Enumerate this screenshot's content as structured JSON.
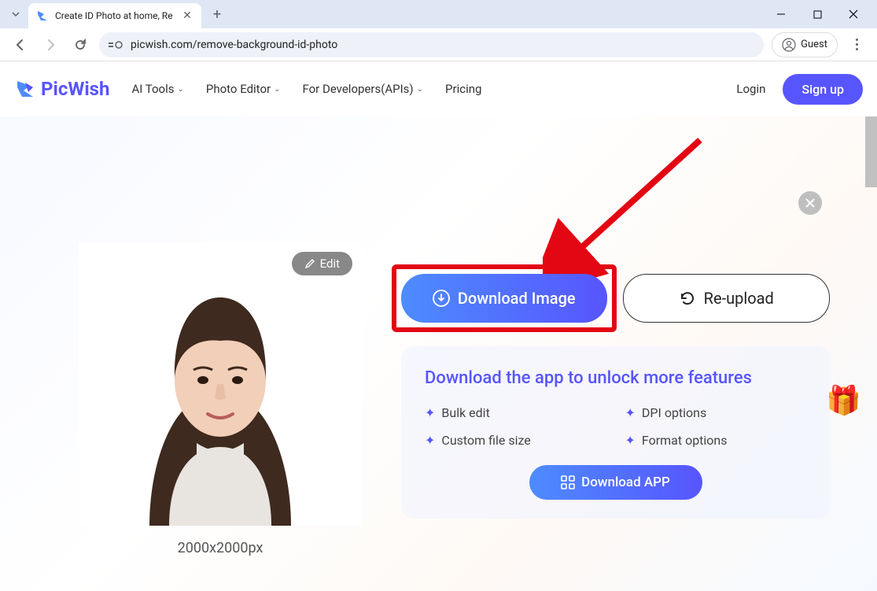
{
  "browser": {
    "tab_title": "Create ID Photo at home, Re",
    "url": "picwish.com/remove-background-id-photo",
    "guest_label": "Guest"
  },
  "header": {
    "brand": "PicWish",
    "nav": {
      "ai_tools": "AI Tools",
      "photo_editor": "Photo Editor",
      "for_developers": "For Developers(APIs)",
      "pricing": "Pricing"
    },
    "login": "Login",
    "signup": "Sign up"
  },
  "editor": {
    "edit_label": "Edit",
    "dimensions": "2000x2000px",
    "download_image": "Download Image",
    "reupload": "Re-upload"
  },
  "features": {
    "title": "Download the app to unlock more features",
    "items": {
      "bulk": "Bulk edit",
      "dpi": "DPI options",
      "custom": "Custom file size",
      "format": "Format options"
    },
    "download_app": "Download APP"
  }
}
